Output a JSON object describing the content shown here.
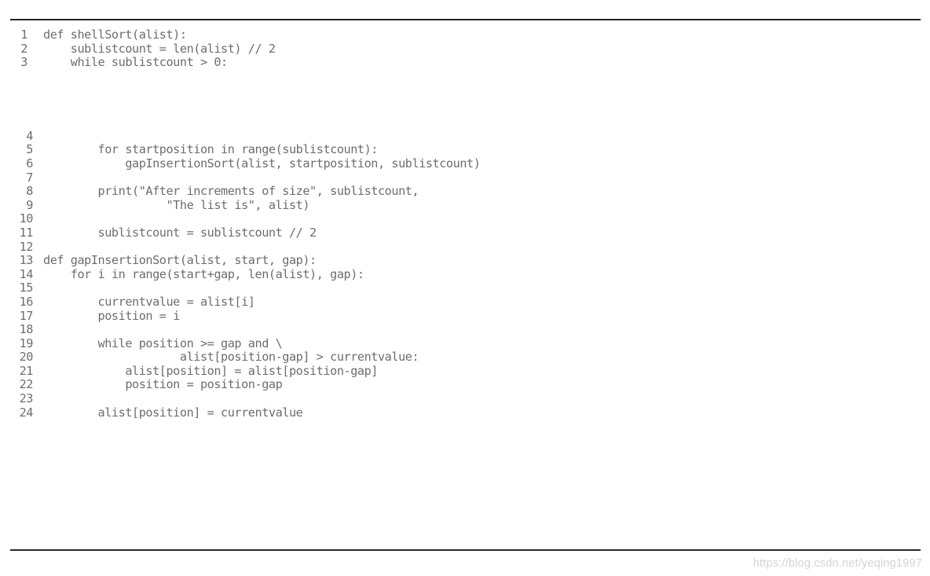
{
  "document": {
    "type": "code-listing",
    "language": "python",
    "title": "shellSort implementation",
    "text_color": "#6d6d6d",
    "rule_color": "#262626",
    "background": "#ffffff"
  },
  "rules": {
    "top_label": "top-horizontal-rule",
    "bottom_label": "bottom-horizontal-rule"
  },
  "code": {
    "lines": [
      {
        "number": "1",
        "text": "def shellSort(alist):"
      },
      {
        "number": "2",
        "text": "    sublistcount = len(alist) // 2"
      },
      {
        "number": "3",
        "text": "    while sublistcount > 0:"
      },
      {
        "number": "4",
        "text": ""
      },
      {
        "number": "5",
        "text": "        for startposition in range(sublistcount):"
      },
      {
        "number": "6",
        "text": "            gapInsertionSort(alist, startposition, sublistcount)"
      },
      {
        "number": "7",
        "text": ""
      },
      {
        "number": "8",
        "text": "        print(\"After increments of size\", sublistcount,"
      },
      {
        "number": "9",
        "text": "                  \"The list is\", alist)"
      },
      {
        "number": "10",
        "text": ""
      },
      {
        "number": "11",
        "text": "        sublistcount = sublistcount // 2"
      },
      {
        "number": "12",
        "text": ""
      },
      {
        "number": "13",
        "text": "def gapInsertionSort(alist, start, gap):"
      },
      {
        "number": "14",
        "text": "    for i in range(start+gap, len(alist), gap):"
      },
      {
        "number": "15",
        "text": ""
      },
      {
        "number": "16",
        "text": "        currentvalue = alist[i]"
      },
      {
        "number": "17",
        "text": "        position = i"
      },
      {
        "number": "18",
        "text": ""
      },
      {
        "number": "19",
        "text": "        while position >= gap and \\"
      },
      {
        "number": "20",
        "text": "                    alist[position-gap] > currentvalue:"
      },
      {
        "number": "21",
        "text": "            alist[position] = alist[position-gap]"
      },
      {
        "number": "22",
        "text": "            position = position-gap"
      },
      {
        "number": "23",
        "text": ""
      },
      {
        "number": "24",
        "text": "        alist[position] = currentvalue"
      }
    ],
    "blank_gap_after_line": "3"
  },
  "watermark": {
    "text": "https://blog.csdn.net/yeqing1997",
    "color": "#d4d4d4"
  }
}
